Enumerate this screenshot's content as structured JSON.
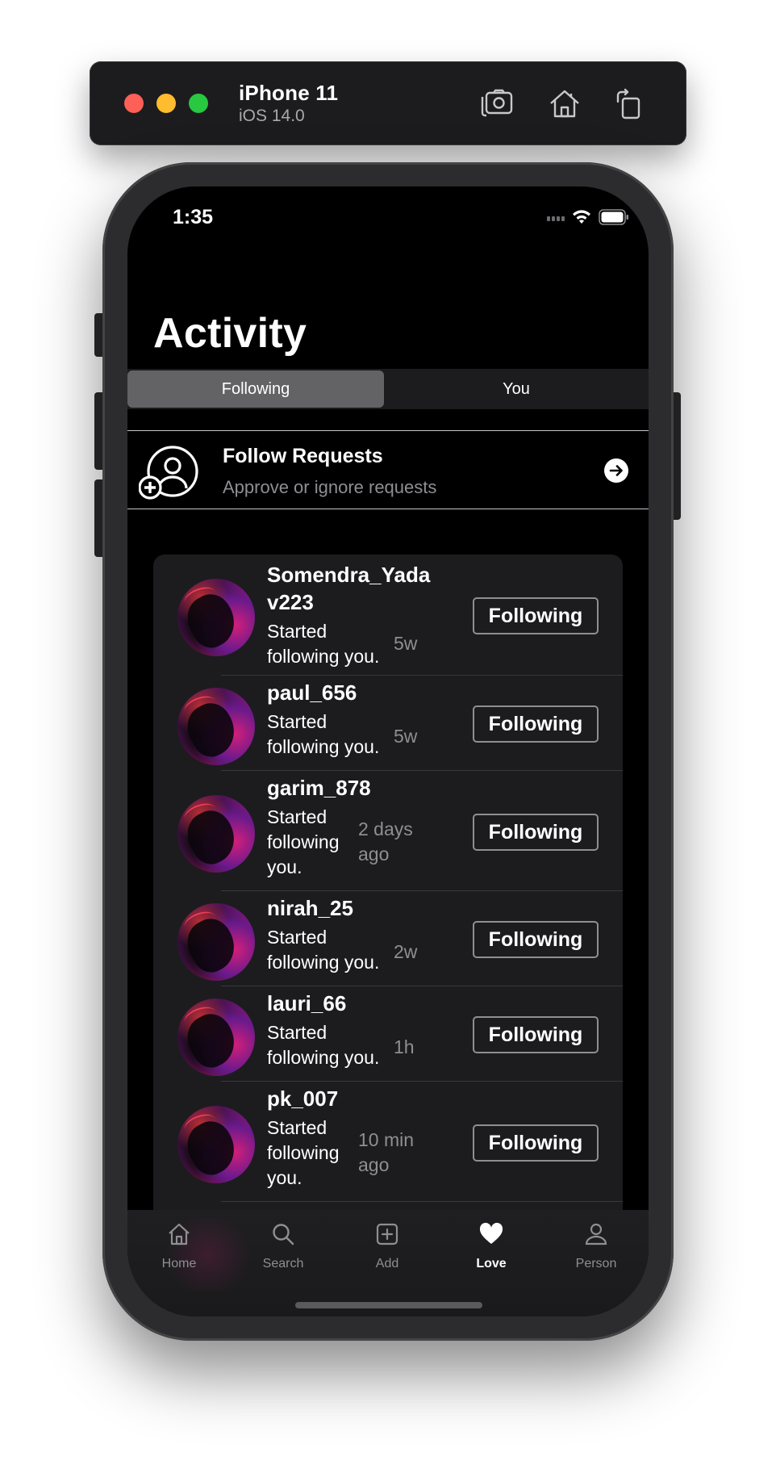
{
  "simulator": {
    "device_name": "iPhone 11",
    "os_version": "iOS 14.0",
    "icons": [
      "camera-screenshot-icon",
      "home-icon",
      "rotate-icon"
    ]
  },
  "status_bar": {
    "time": "1:35"
  },
  "header": {
    "title": "Activity"
  },
  "segments": [
    {
      "label": "Following",
      "selected": true
    },
    {
      "label": "You",
      "selected": false
    }
  ],
  "follow_requests": {
    "title": "Follow Requests",
    "subtitle": "Approve or ignore requests"
  },
  "activity": [
    {
      "username_lines": [
        "Somendra_Yada",
        "v223"
      ],
      "message_lines": [
        "Started",
        "following you."
      ],
      "time_lines": [
        "5w"
      ],
      "button": "Following"
    },
    {
      "username_lines": [
        "paul_656"
      ],
      "message_lines": [
        "Started",
        "following you."
      ],
      "time_lines": [
        "5w"
      ],
      "button": "Following"
    },
    {
      "username_lines": [
        "garim_878"
      ],
      "message_lines": [
        "Started",
        "following",
        "you."
      ],
      "time_lines": [
        "2 days",
        "ago"
      ],
      "button": "Following"
    },
    {
      "username_lines": [
        "nirah_25"
      ],
      "message_lines": [
        "Started",
        "following you."
      ],
      "time_lines": [
        "2w"
      ],
      "button": "Following"
    },
    {
      "username_lines": [
        "lauri_66"
      ],
      "message_lines": [
        "Started",
        "following you."
      ],
      "time_lines": [
        "1h"
      ],
      "button": "Following"
    },
    {
      "username_lines": [
        "pk_007"
      ],
      "message_lines": [
        "Started",
        "following",
        "you."
      ],
      "time_lines": [
        "10 min",
        "ago"
      ],
      "button": "Following"
    }
  ],
  "tabbar": [
    {
      "label": "Home",
      "icon": "home-icon",
      "active": false
    },
    {
      "label": "Search",
      "icon": "search-icon",
      "active": false
    },
    {
      "label": "Add",
      "icon": "add-square-icon",
      "active": false
    },
    {
      "label": "Love",
      "icon": "heart-icon",
      "active": true
    },
    {
      "label": "Person",
      "icon": "person-icon",
      "active": false
    }
  ],
  "colors": {
    "background": "#000000",
    "card": "#1c1c1e",
    "secondary_text": "#8e8e93",
    "segment_selected": "#636366"
  }
}
